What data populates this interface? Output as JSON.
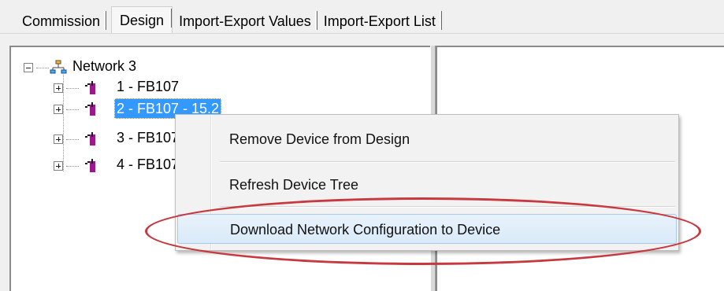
{
  "tabs": [
    {
      "label": "Commission",
      "active": false
    },
    {
      "label": "Design",
      "active": true
    },
    {
      "label": "Import-Export Values",
      "active": false
    },
    {
      "label": "Import-Export List",
      "active": false
    }
  ],
  "tree": {
    "root": {
      "label": "Network 3",
      "icon": "network-icon",
      "expanded": true
    },
    "children": [
      {
        "label": "1 - FB107",
        "icon": "device-icon",
        "selected": false
      },
      {
        "label": "2 - FB107 - 15.2",
        "icon": "device-icon",
        "selected": true
      },
      {
        "label": "3 - FB107",
        "icon": "device-icon",
        "selected": false
      },
      {
        "label": "4 - FB107",
        "icon": "device-icon",
        "selected": false
      }
    ]
  },
  "context_menu": {
    "items": [
      {
        "label": "Remove Device from Design",
        "highlighted": false
      },
      {
        "label": "Refresh Device Tree",
        "highlighted": false
      },
      {
        "label": "Download Network Configuration to Device",
        "highlighted": true
      }
    ]
  },
  "colors": {
    "selection": "#3399ff",
    "annotation": "#c8383f",
    "menu_highlight": "#d9eaf9"
  }
}
